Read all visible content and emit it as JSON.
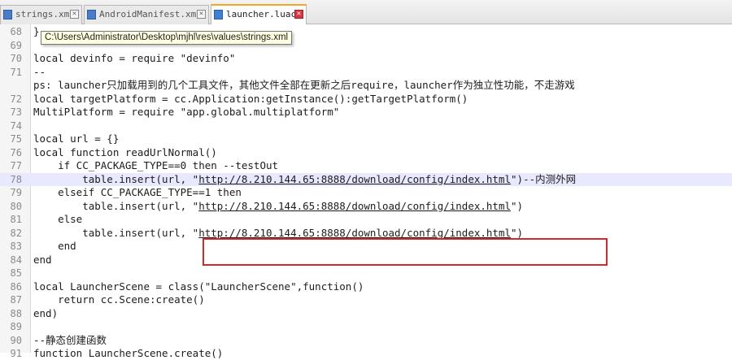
{
  "tabs": [
    {
      "label": "strings.xml",
      "active": false
    },
    {
      "label": "AndroidManifest.xml",
      "active": false
    },
    {
      "label": "launcher.luac",
      "active": true
    }
  ],
  "tooltip": "C:\\Users\\Administrator\\Desktop\\mjhl\\res\\values\\strings.xml",
  "lines": [
    {
      "num": "68",
      "text": "}"
    },
    {
      "num": "69",
      "text": ""
    },
    {
      "num": "70",
      "text": "local devinfo = require \"devinfo\""
    },
    {
      "num": "71",
      "text": "--"
    },
    {
      "num": "",
      "text": "ps: launcher只加载用到的几个工具文件，其他文件全部在更新之后require，launcher作为独立性功能，不走游戏"
    },
    {
      "num": "72",
      "text": "local targetPlatform = cc.Application:getInstance():getTargetPlatform()"
    },
    {
      "num": "73",
      "text": "MultiPlatform = require \"app.global.multiplatform\""
    },
    {
      "num": "74",
      "text": ""
    },
    {
      "num": "75",
      "text": "local url = {}"
    },
    {
      "num": "76",
      "text": "local function readUrlNormal()"
    },
    {
      "num": "77",
      "text": "    if CC_PACKAGE_TYPE==0 then --testOut"
    },
    {
      "num": "78",
      "pre": "        table.insert(url, \"",
      "url": "http://8.210.144.65:8888/download/config/index.html",
      "post": "\")--内测外网"
    },
    {
      "num": "79",
      "text": "    elseif CC_PACKAGE_TYPE==1 then"
    },
    {
      "num": "80",
      "pre": "        table.insert(url, \"",
      "url": "http://8.210.144.65:8888/download/config/index.html",
      "post": "\")"
    },
    {
      "num": "81",
      "text": "    else"
    },
    {
      "num": "82",
      "pre": "        table.insert(url, \"",
      "url": "http://8.210.144.65:8888/download/config/index.html",
      "post": "\")"
    },
    {
      "num": "83",
      "text": "    end"
    },
    {
      "num": "84",
      "text": "end"
    },
    {
      "num": "85",
      "text": ""
    },
    {
      "num": "86",
      "text": "local LauncherScene = class(\"LauncherScene\",function()"
    },
    {
      "num": "87",
      "text": "    return cc.Scene:create()"
    },
    {
      "num": "88",
      "text": "end)"
    },
    {
      "num": "89",
      "text": ""
    },
    {
      "num": "90",
      "text": "--静态创建函数"
    },
    {
      "num": "91",
      "text": "function LauncherScene.create()"
    }
  ]
}
